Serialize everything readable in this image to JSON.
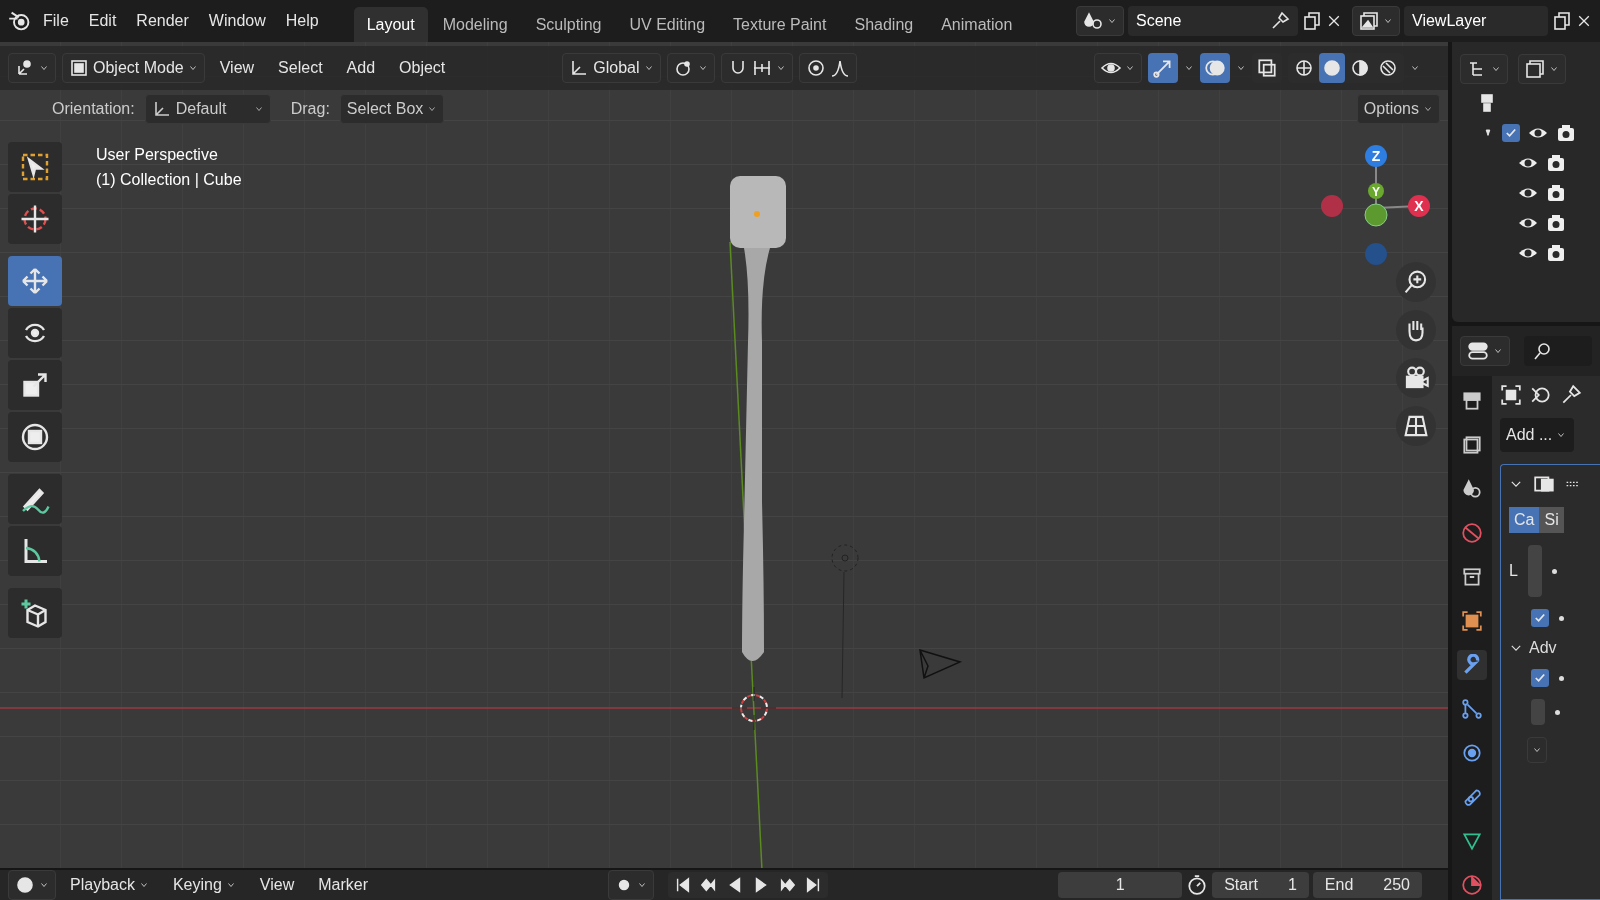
{
  "top_menu": [
    "File",
    "Edit",
    "Render",
    "Window",
    "Help"
  ],
  "workspaces": [
    {
      "label": "Layout",
      "selected": true
    },
    {
      "label": "Modeling",
      "selected": false
    },
    {
      "label": "Sculpting",
      "selected": false
    },
    {
      "label": "UV Editing",
      "selected": false
    },
    {
      "label": "Texture Paint",
      "selected": false
    },
    {
      "label": "Shading",
      "selected": false
    },
    {
      "label": "Animation",
      "selected": false
    }
  ],
  "scene": "Scene",
  "view_layer": "ViewLayer",
  "header": {
    "mode": "Object Mode",
    "menus": [
      "View",
      "Select",
      "Add",
      "Object"
    ],
    "orientation": "Global",
    "gizmos_on": true,
    "overlays_on": true,
    "shading": [
      {
        "kind": "wireframe",
        "selected": false
      },
      {
        "kind": "solid",
        "selected": true
      },
      {
        "kind": "material",
        "selected": false
      },
      {
        "kind": "rendered",
        "selected": false
      }
    ]
  },
  "tool_settings": {
    "orientation_label": "Orientation:",
    "orientation": "Default",
    "drag_label": "Drag:",
    "drag": "Select Box",
    "options": "Options"
  },
  "toolbar": [
    {
      "kind": "select",
      "selected": false
    },
    {
      "kind": "cursor",
      "selected": false
    },
    {
      "kind": "move",
      "selected": true
    },
    {
      "kind": "rotate",
      "selected": false
    },
    {
      "kind": "scale",
      "selected": false
    },
    {
      "kind": "transform",
      "selected": false
    },
    {
      "kind": "annotate",
      "selected": false
    },
    {
      "kind": "measure",
      "selected": false
    },
    {
      "kind": "add_cube",
      "selected": false
    }
  ],
  "viewport": {
    "info": [
      "User Perspective",
      "(1) Collection | Cube"
    ],
    "gizmo": {
      "z": "Z",
      "y": "Y",
      "x": "X"
    }
  },
  "outliner": {
    "collection": {
      "expanded": true,
      "checked": true,
      "visible": true,
      "renderable": true
    },
    "children": [
      {
        "visible": true,
        "renderable": true
      },
      {
        "visible": true,
        "renderable": true
      },
      {
        "visible": true,
        "renderable": true
      },
      {
        "visible": true,
        "renderable": true
      }
    ]
  },
  "properties": {
    "tabs": [
      {
        "kind": "render",
        "selected": false
      },
      {
        "kind": "output",
        "selected": false
      },
      {
        "kind": "scene",
        "selected": false
      },
      {
        "kind": "world",
        "selected": false
      },
      {
        "kind": "collection",
        "selected": false
      },
      {
        "kind": "object",
        "selected": false
      },
      {
        "kind": "modifiers",
        "selected": true
      },
      {
        "kind": "particles",
        "selected": false
      },
      {
        "kind": "physics",
        "selected": false
      },
      {
        "kind": "constraints",
        "selected": false
      },
      {
        "kind": "data",
        "selected": false
      },
      {
        "kind": "material",
        "selected": false
      }
    ],
    "add_modifier": "Add ...",
    "modifier": {
      "expanded": true,
      "mode_tabs": [
        {
          "label": "Ca",
          "selected": true
        },
        {
          "label": "Si",
          "selected": false
        }
      ],
      "row_label": "L",
      "option_checked": true,
      "section": "Adv",
      "section_expanded": true,
      "section_checked": true
    }
  },
  "timeline": {
    "menus": [
      "Playback",
      "Keying",
      "View",
      "Marker"
    ],
    "frame": "1",
    "start_label": "Start",
    "start": "1",
    "end_label": "End",
    "end": "250"
  }
}
